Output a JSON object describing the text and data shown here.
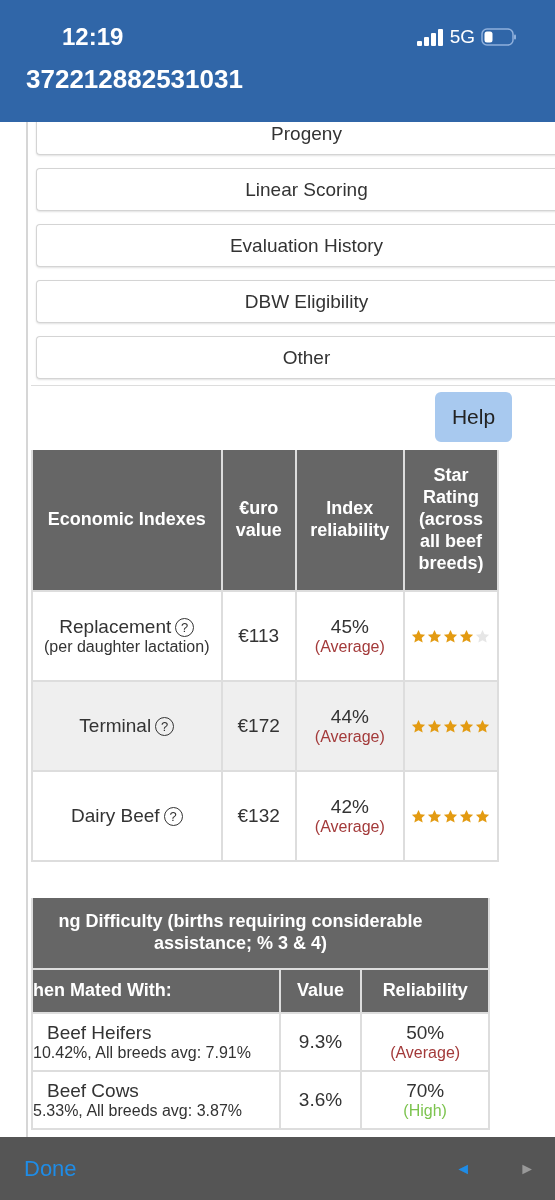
{
  "status_bar": {
    "time": "12:19",
    "network": "5G"
  },
  "header": {
    "title": "372212882531031"
  },
  "menu_buttons": [
    "Progeny",
    "Linear Scoring",
    "Evaluation History",
    "DBW Eligibility",
    "Other"
  ],
  "help_button": "Help",
  "indexes_table": {
    "columns": [
      "Economic Indexes",
      "€uro value",
      "Index reliability",
      "Star Rating (across all beef breeds)"
    ],
    "rows": [
      {
        "name": "Replacement",
        "note": "(per daughter lactation)",
        "help": "?",
        "value": "€113",
        "reliability": "45%",
        "reliability_label": "(Average)",
        "kind": "average",
        "stars": 4
      },
      {
        "name": "Terminal",
        "help": "?",
        "value": "€172",
        "reliability": "44%",
        "reliability_label": "(Average)",
        "kind": "average",
        "stars": 5
      },
      {
        "name": "Dairy Beef",
        "help": "?",
        "value": "€132",
        "reliability": "42%",
        "reliability_label": "(Average)",
        "kind": "average",
        "stars": 5
      }
    ]
  },
  "calving_table": {
    "title": "ng Difficulty (births requiring considerable assistance; % 3 & 4)",
    "columns": [
      "hen Mated With:",
      "Value",
      "Reliability"
    ],
    "rows": [
      {
        "name": "Beef Heifers",
        "note": "10.42%, All breeds avg: 7.91%",
        "value": "9.3%",
        "reliability": "50%",
        "reliability_label": "(Average)",
        "kind": "average"
      },
      {
        "name": "Beef Cows",
        "note": "5.33%, All breeds avg: 3.87%",
        "value": "3.6%",
        "reliability": "70%",
        "reliability_label": "(High)",
        "kind": "high"
      }
    ]
  },
  "toolbar": {
    "done": "Done",
    "prev": {
      "label": "◄",
      "disabled": false
    },
    "next": {
      "label": "►",
      "disabled": true
    }
  }
}
